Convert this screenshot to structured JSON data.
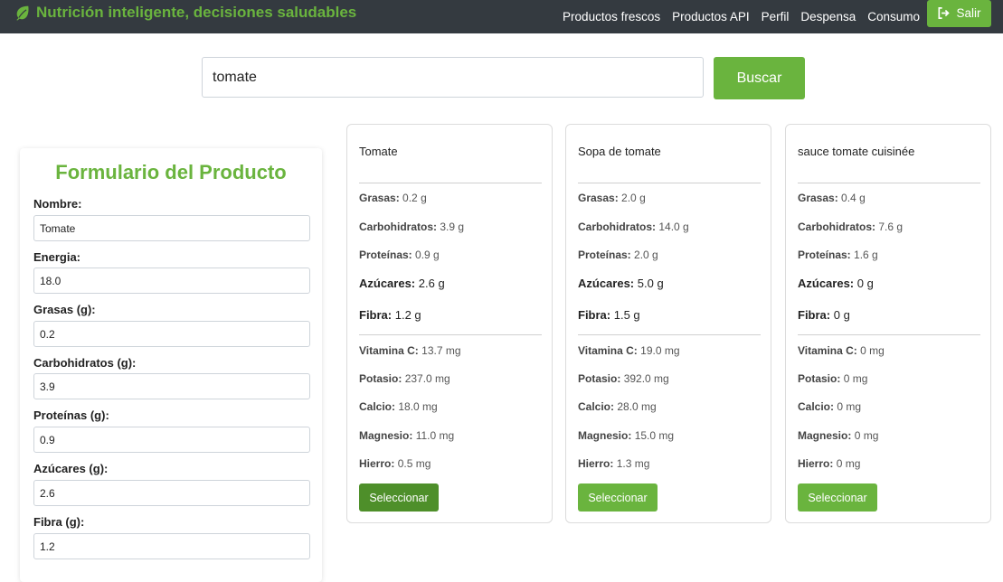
{
  "navbar": {
    "title": "Nutrición inteligente, decisiones saludables",
    "links": [
      "Productos frescos",
      "Productos API",
      "Perfil",
      "Despensa",
      "Consumo"
    ],
    "logout_label": "Salir"
  },
  "search": {
    "value": "tomate",
    "button_label": "Buscar"
  },
  "form": {
    "title": "Formulario del Producto",
    "fields": [
      {
        "label": "Nombre:",
        "value": "Tomate"
      },
      {
        "label": "Energia:",
        "value": "18.0"
      },
      {
        "label": "Grasas (g):",
        "value": "0.2"
      },
      {
        "label": "Carbohidratos (g):",
        "value": "3.9"
      },
      {
        "label": "Proteínas (g):",
        "value": "0.9"
      },
      {
        "label": "Azúcares (g):",
        "value": "2.6"
      },
      {
        "label": "Fibra (g):",
        "value": "1.2"
      }
    ]
  },
  "products": [
    {
      "name": "Tomate",
      "grasas": "0.2 g",
      "carbohidratos": "3.9 g",
      "proteinas": "0.9 g",
      "azucares": "2.6 g",
      "fibra": "1.2 g",
      "vitamina_c": "13.7 mg",
      "potasio": "237.0 mg",
      "calcio": "18.0 mg",
      "magnesio": "11.0 mg",
      "hierro": "0.5 mg",
      "button_label": "Seleccionar"
    },
    {
      "name": "Sopa de tomate",
      "grasas": "2.0 g",
      "carbohidratos": "14.0 g",
      "proteinas": "2.0 g",
      "azucares": "5.0 g",
      "fibra": "1.5 g",
      "vitamina_c": "19.0 mg",
      "potasio": "392.0 mg",
      "calcio": "28.0 mg",
      "magnesio": "15.0 mg",
      "hierro": "1.3 mg",
      "button_label": "Seleccionar"
    },
    {
      "name": "sauce tomate cuisinée",
      "grasas": "0.4 g",
      "carbohidratos": "7.6 g",
      "proteinas": "1.6 g",
      "azucares": "0 g",
      "fibra": "0 g",
      "vitamina_c": "0 mg",
      "potasio": "0 mg",
      "calcio": "0 mg",
      "magnesio": "0 mg",
      "hierro": "0 mg",
      "button_label": "Seleccionar"
    }
  ],
  "nutrient_labels": {
    "grasas": "Grasas:",
    "carbohidratos": "Carbohidratos:",
    "proteinas": "Proteínas:",
    "azucares": "Azúcares:",
    "fibra": "Fibra:",
    "vitamina_c": "Vitamina C:",
    "potasio": "Potasio:",
    "calcio": "Calcio:",
    "magnesio": "Magnesio:",
    "hierro": "Hierro:"
  },
  "colors": {
    "brand": "#6ab43e",
    "navbar": "#343a40",
    "button_active": "#4e8f2a"
  },
  "icons": {
    "brand": "leaf-icon",
    "logout": "sign-out-icon"
  }
}
